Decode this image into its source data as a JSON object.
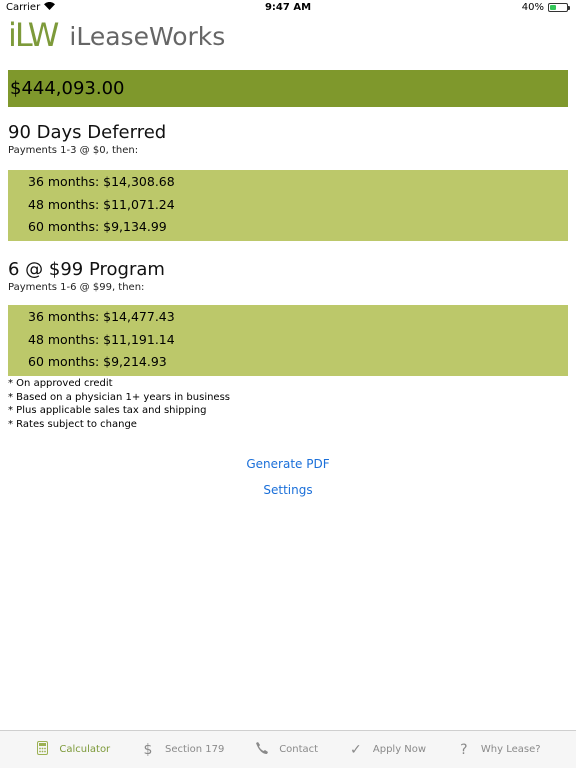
{
  "status_bar": {
    "carrier": "Carrier",
    "time": "9:47 AM",
    "battery": "40%",
    "battery_level": 0.4
  },
  "header": {
    "logo_mark": "iLW",
    "app_name": "iLeaseWorks"
  },
  "total": "$444,093.00",
  "plans": [
    {
      "title": "90 Days Deferred",
      "subtitle": "Payments 1-3 @ $0, then:",
      "rates": [
        "36 months: $14,308.68",
        "48 months: $11,071.24",
        "60 months: $9,134.99"
      ]
    },
    {
      "title": "6 @ $99 Program",
      "subtitle": "Payments 1-6 @ $99, then:",
      "rates": [
        "36 months: $14,477.43",
        "48 months: $11,191.14",
        "60 months: $9,214.93"
      ]
    }
  ],
  "notes": [
    "* On approved credit",
    "* Based on a physician 1+ years in business",
    "* Plus applicable sales tax and shipping",
    "* Rates subject to change"
  ],
  "actions": {
    "generate_pdf": "Generate PDF",
    "settings": "Settings"
  },
  "tabs": [
    {
      "label": "Calculator",
      "icon": "calculator-icon",
      "active": true
    },
    {
      "label": "Section 179",
      "icon": "dollar-icon",
      "active": false
    },
    {
      "label": "Contact",
      "icon": "phone-icon",
      "active": false
    },
    {
      "label": "Apply Now",
      "icon": "checkmark-icon",
      "active": false
    },
    {
      "label": "Why Lease?",
      "icon": "question-icon",
      "active": false
    }
  ],
  "colors": {
    "accent": "#7f982c",
    "rate_box": "#bcc86a",
    "link": "#1a6fd9"
  }
}
